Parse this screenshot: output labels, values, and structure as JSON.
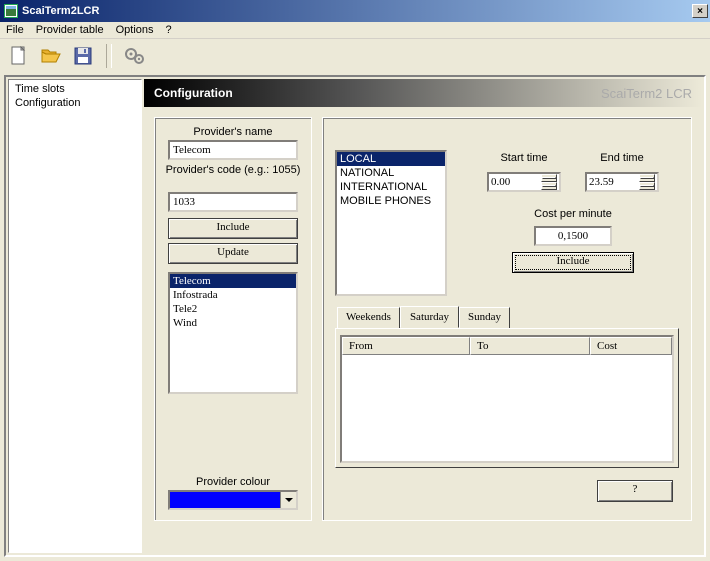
{
  "window": {
    "title": "ScaiTerm2LCR",
    "close": "×"
  },
  "menu": {
    "file": "File",
    "provider_table": "Provider table",
    "options": "Options",
    "help": "?"
  },
  "sidebar": {
    "items": [
      {
        "label": "Time slots"
      },
      {
        "label": "Configuration"
      }
    ]
  },
  "header": {
    "title": "Configuration",
    "product": "ScaiTerm2 LCR"
  },
  "provider": {
    "name_label": "Provider's name",
    "name_value": "Telecom",
    "code_label": "Provider's code (e.g.: 1055)",
    "code_value": "1033",
    "include_btn": "Include",
    "update_btn": "Update",
    "list": [
      "Telecom",
      "Infostrada",
      "Tele2",
      "Wind"
    ],
    "selected_index": 0,
    "colour_label": "Provider colour",
    "colour_value": "#0000ff"
  },
  "categories": {
    "list": [
      "LOCAL",
      "NATIONAL",
      "INTERNATIONAL",
      "MOBILE PHONES"
    ],
    "selected_index": 0
  },
  "times": {
    "start_label": "Start time",
    "start_value": "0.00",
    "end_label": "End time",
    "end_value": "23.59",
    "cost_label": "Cost per minute",
    "cost_value": "0,1500",
    "include_btn": "Include"
  },
  "tabs": {
    "items": [
      "Weekends",
      "Saturday",
      "Sunday"
    ],
    "active_index": 1
  },
  "grid": {
    "columns": [
      "From",
      "To",
      "Cost"
    ]
  },
  "help_btn": "?"
}
